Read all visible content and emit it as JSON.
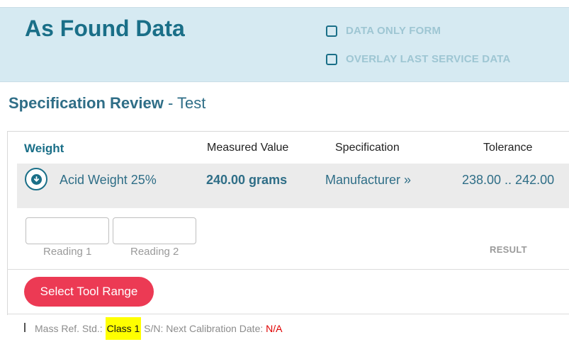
{
  "header": {
    "title": "As Found Data",
    "options": [
      {
        "label": "DATA ONLY FORM",
        "checked": false
      },
      {
        "label": "OVERLAY LAST SERVICE DATA",
        "checked": false
      }
    ]
  },
  "section": {
    "title_strong": "Specification Review",
    "title_rest": " - Test"
  },
  "table": {
    "columns": [
      "Weight",
      "Measured Value",
      "Specification",
      "Tolerance"
    ],
    "row": {
      "name": "Acid Weight 25%",
      "measured_value": "240.00  grams",
      "specification": "Manufacturer »",
      "tolerance": "238.00 .. 242.00"
    }
  },
  "readings": [
    {
      "label": "Reading 1",
      "value": ""
    },
    {
      "label": "Reading 2",
      "value": ""
    }
  ],
  "result_label": "RESULT",
  "tool_button": "Select Tool Range",
  "footer": {
    "prefix": "Mass Ref. Std.: ",
    "class_value": "Class 1",
    "middle": " S/N: Next Calibration Date: ",
    "date_value": "N/A"
  },
  "colors": {
    "accent": "#1a6f88",
    "header_bg": "#d6eaf2",
    "button": "#ec3a54",
    "highlight": "#ffff00",
    "na_text": "#e00000"
  },
  "icons": {
    "row_expand": "download-arrow-circle-icon",
    "checkbox": "checkbox-icon"
  }
}
